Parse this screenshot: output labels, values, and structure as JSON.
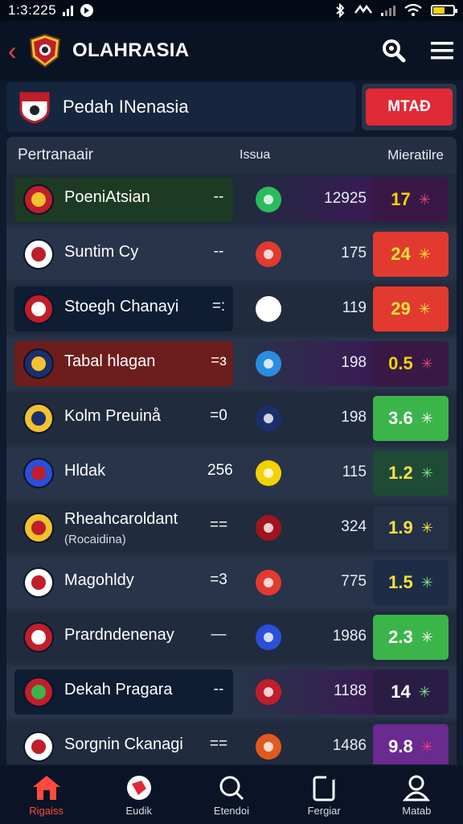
{
  "status_bar": {
    "time": "1:3:225",
    "signal_label": "ııl"
  },
  "header": {
    "title": "OLAHRASIA"
  },
  "league": {
    "name": "Pedah INenasia"
  },
  "match_button": {
    "label": "MTAƉ"
  },
  "table": {
    "headers": {
      "team": "Pertranaair",
      "mid": "Issua",
      "right": "Mieratilre"
    },
    "rows": [
      {
        "name": "PoeniAtsian",
        "sub": "",
        "dash": "--",
        "num": "12925",
        "odds": "17",
        "team_bg": "#1d3a24",
        "strip": "#3a1a55",
        "odds_bg": "#3a1845",
        "odds_color": "#f5d400",
        "star_color": "#e0457a"
      },
      {
        "name": "Suntim Cy",
        "sub": "",
        "dash": "--",
        "num": "175",
        "odds": "24",
        "team_bg": "",
        "strip": "",
        "odds_bg": "#e23a2f",
        "odds_color": "#f7e23c",
        "star_color": "#f7e23c"
      },
      {
        "name": "Stoegh Chanayi",
        "sub": "",
        "dash": "=:",
        "num": "119",
        "odds": "29",
        "team_bg": "#0f1d33",
        "strip": "",
        "odds_bg": "#e23a2f",
        "odds_color": "#f7e23c",
        "star_color": "#f7e23c"
      },
      {
        "name": "Tabal hlagan",
        "sub": "",
        "dash": "=ɜ",
        "num": "198",
        "odds": "0.5",
        "team_bg": "#6e1d1d",
        "strip": "#3a1a55",
        "odds_bg": "#3a1845",
        "odds_color": "#f5d400",
        "star_color": "#e0457a"
      },
      {
        "name": "Kolm Preuinå",
        "sub": "",
        "dash": "=0",
        "num": "198",
        "odds": "3.6",
        "team_bg": "",
        "strip": "",
        "odds_bg": "#3bb54a",
        "odds_color": "#ffffff",
        "star_color": "#ffffff"
      },
      {
        "name": "Hldak",
        "sub": "",
        "dash": "256",
        "num": "115",
        "odds": "1.2",
        "team_bg": "",
        "strip": "",
        "odds_bg": "#1e4a36",
        "odds_color": "#f7e23c",
        "star_color": "#7fe08a"
      },
      {
        "name": "Rheahcaroldant",
        "sub": "(Rocaidina)",
        "dash": "==",
        "num": "324",
        "odds": "1.9",
        "team_bg": "",
        "strip": "",
        "odds_bg": "#243046",
        "odds_color": "#f7e23c",
        "star_color": "#f7e23c"
      },
      {
        "name": "Magohldy",
        "sub": "",
        "dash": "=3",
        "num": "775",
        "odds": "1.5",
        "team_bg": "",
        "strip": "",
        "odds_bg": "#1c2d45",
        "odds_color": "#f7e23c",
        "star_color": "#7fe08a"
      },
      {
        "name": "Prardndenenay",
        "sub": "",
        "dash": "—",
        "num": "1986",
        "odds": "2.3",
        "team_bg": "",
        "strip": "",
        "odds_bg": "#3bb54a",
        "odds_color": "#ffffff",
        "star_color": "#ffffff"
      },
      {
        "name": "Dekah Pragara",
        "sub": "",
        "dash": "--",
        "num": "1188",
        "odds": "14",
        "team_bg": "#0f1d33",
        "strip": "#3a1a55",
        "odds_bg": "#2a1d45",
        "odds_color": "#ffffff",
        "star_color": "#7fe08a"
      },
      {
        "name": "Sorgnin Ckanagi",
        "sub": "",
        "dash": "==",
        "num": "1486",
        "odds": "9.8",
        "team_bg": "",
        "strip": "",
        "odds_bg": "#6a2a90",
        "odds_color": "#ffffff",
        "star_color": "#e0457a"
      }
    ]
  },
  "bottom_nav": [
    {
      "label": "Rigaiss",
      "icon": "home-icon"
    },
    {
      "label": "Eudik",
      "icon": "sport-icon"
    },
    {
      "label": "Etendoi",
      "icon": "search-icon"
    },
    {
      "label": "Fergiar",
      "icon": "tablet-icon"
    },
    {
      "label": "Matab",
      "icon": "profile-icon"
    }
  ],
  "colors": {
    "accent": "#e23a2f",
    "green": "#3bb54a",
    "background": "#0f1a2e"
  }
}
